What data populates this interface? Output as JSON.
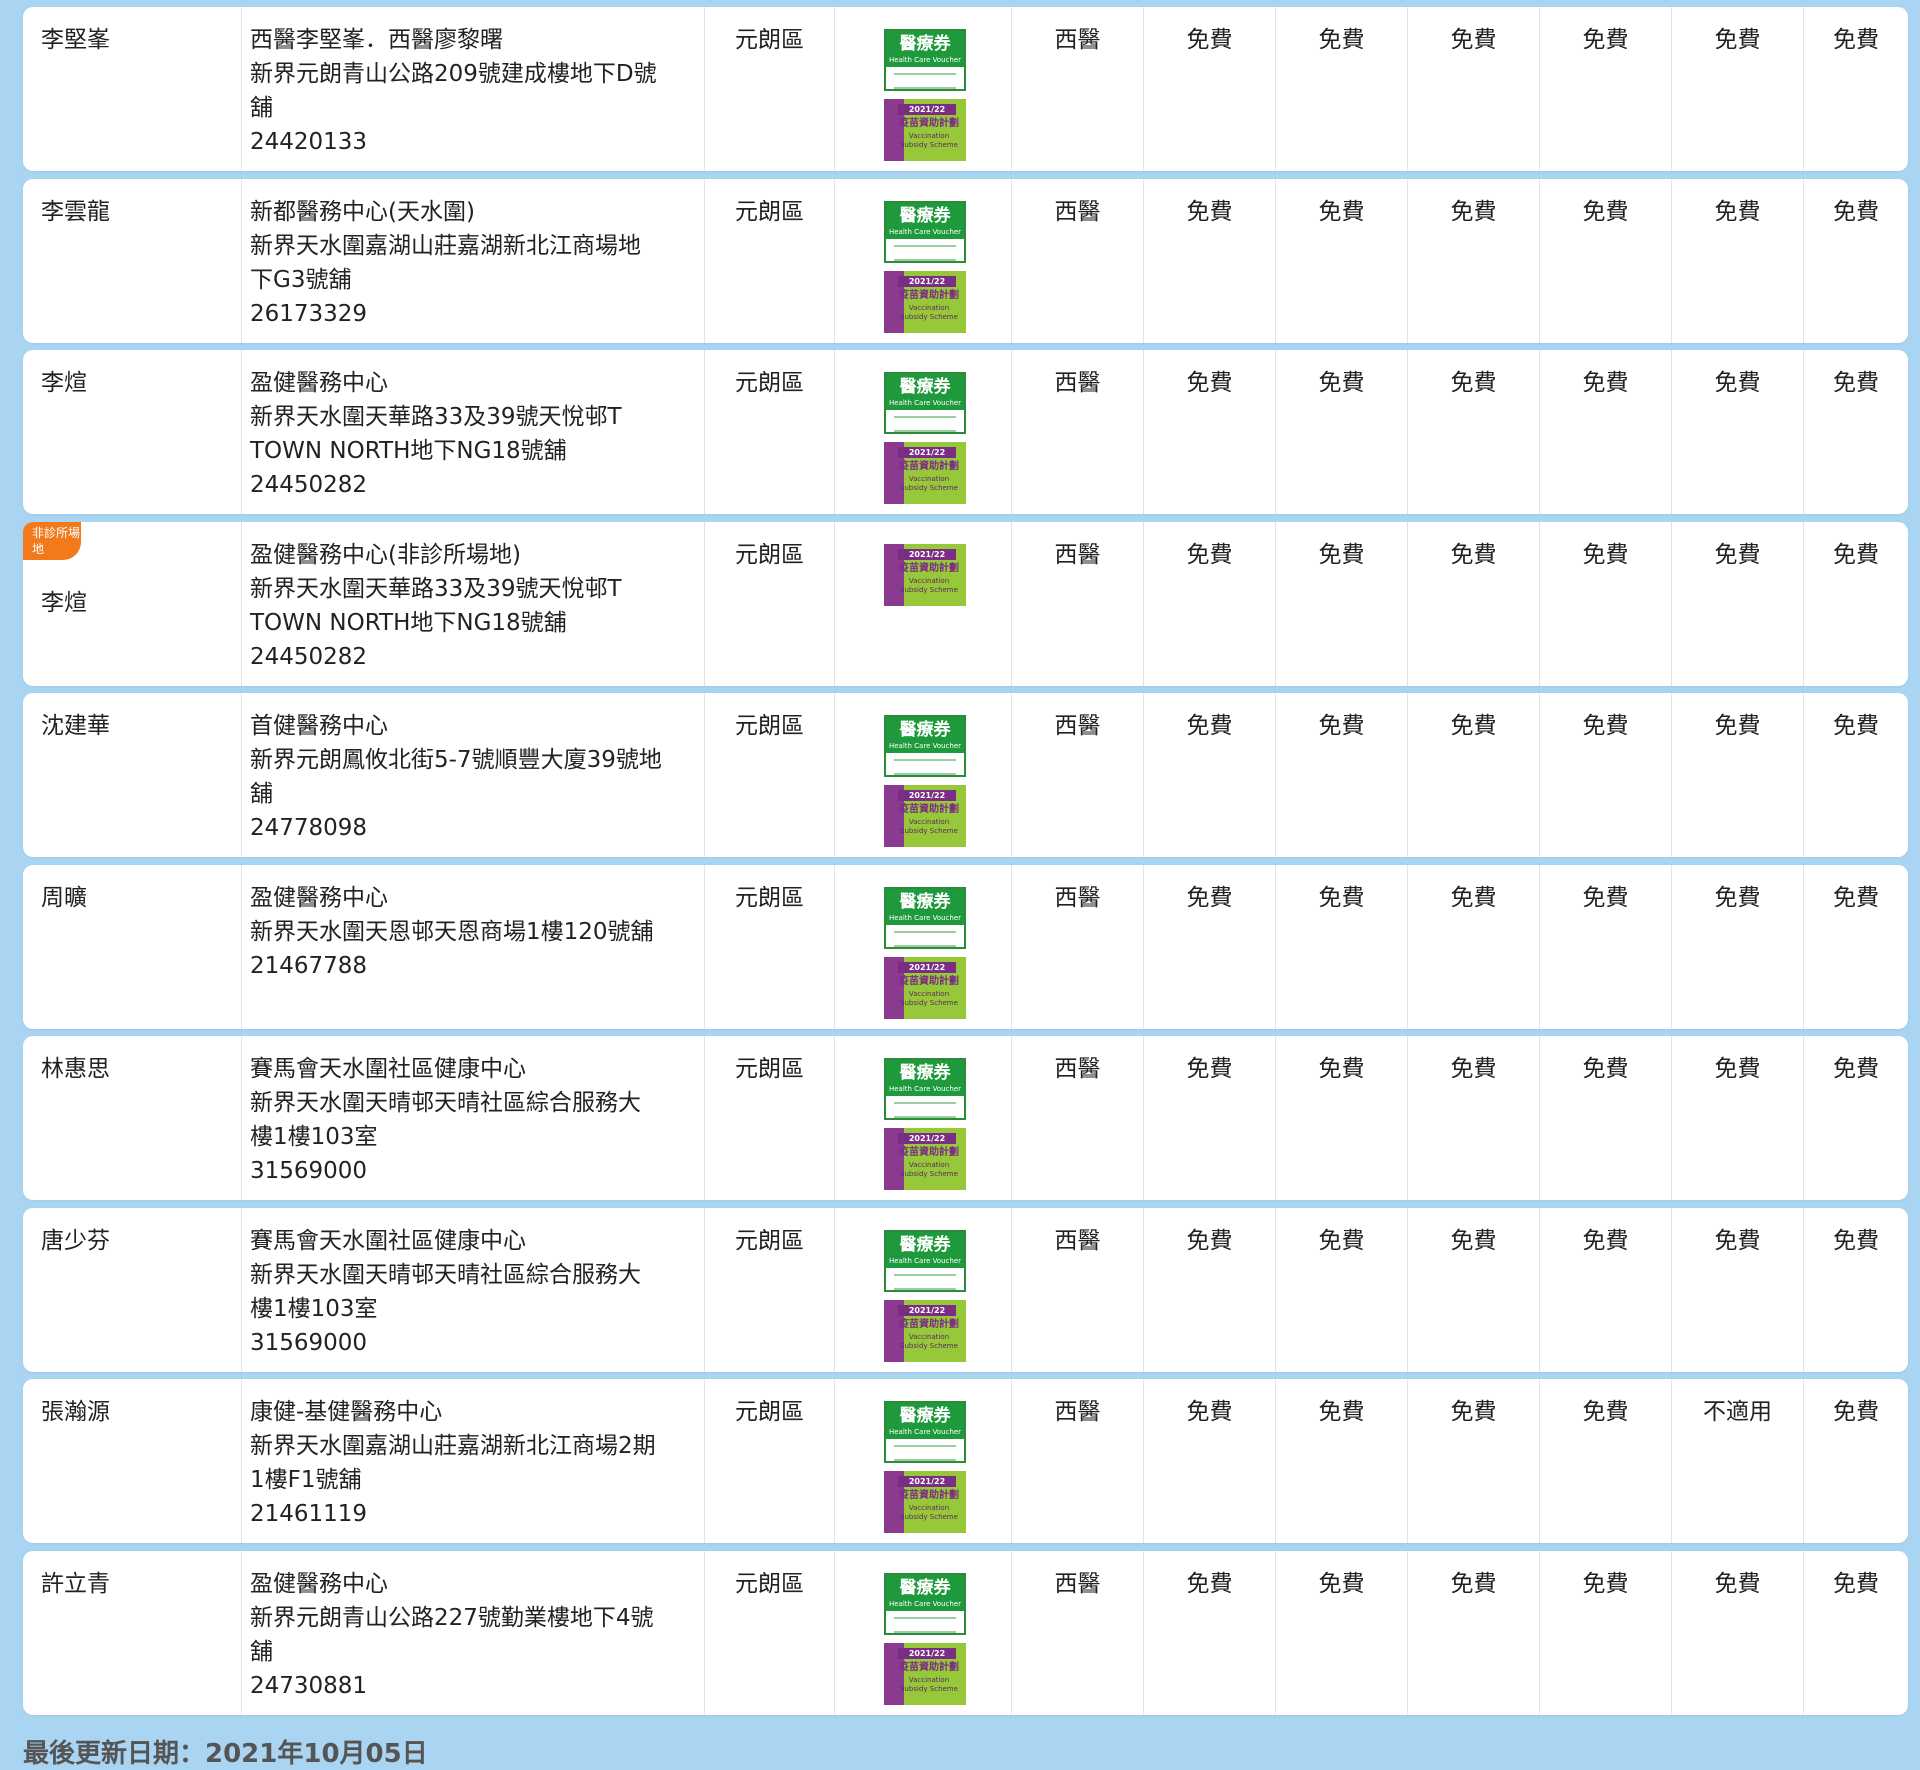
{
  "icons": {
    "hcv_title": "醫療券",
    "hcv_en": "Health Care Voucher",
    "vss_year": "2021/22",
    "vss_zh": "疫苗資助計劃",
    "vss_en": "Vaccination Subsidy Scheme"
  },
  "badge_label": "非診所場地",
  "rows": [
    {
      "name": "李堅峯",
      "address_lines": [
        "西醫李堅峯．西醫廖黎曙",
        "新界元朗青山公路209號建成樓地下D號",
        "舖",
        "24420133"
      ],
      "district": "元朗區",
      "hcv": true,
      "vss": true,
      "type": "西醫",
      "fees": [
        "免費",
        "免費",
        "免費",
        "免費",
        "免費",
        "免費"
      ],
      "badge": false
    },
    {
      "name": "李雲龍",
      "address_lines": [
        "新都醫務中心(天水圍)",
        "新界天水圍嘉湖山莊嘉湖新北江商場地",
        "下G3號舖",
        "26173329"
      ],
      "district": "元朗區",
      "hcv": true,
      "vss": true,
      "type": "西醫",
      "fees": [
        "免費",
        "免費",
        "免費",
        "免費",
        "免費",
        "免費"
      ],
      "badge": false
    },
    {
      "name": "李煊",
      "address_lines": [
        "盈健醫務中心",
        "新界天水圍天華路33及39號天悅邨T",
        "TOWN NORTH地下NG18號舖",
        "24450282"
      ],
      "district": "元朗區",
      "hcv": true,
      "vss": true,
      "type": "西醫",
      "fees": [
        "免費",
        "免費",
        "免費",
        "免費",
        "免費",
        "免費"
      ],
      "badge": false
    },
    {
      "name": "李煊",
      "address_lines": [
        "盈健醫務中心(非診所場地)",
        "新界天水圍天華路33及39號天悅邨T",
        "TOWN NORTH地下NG18號舖",
        "24450282"
      ],
      "district": "元朗區",
      "hcv": false,
      "vss": true,
      "type": "西醫",
      "fees": [
        "免費",
        "免費",
        "免費",
        "免費",
        "免費",
        "免費"
      ],
      "badge": true
    },
    {
      "name": "沈建華",
      "address_lines": [
        "首健醫務中心",
        "新界元朗鳳攸北街5-7號順豐大廈39號地",
        "舖",
        "24778098"
      ],
      "district": "元朗區",
      "hcv": true,
      "vss": true,
      "type": "西醫",
      "fees": [
        "免費",
        "免費",
        "免費",
        "免費",
        "免費",
        "免費"
      ],
      "badge": false
    },
    {
      "name": "周曠",
      "address_lines": [
        "盈健醫務中心",
        "新界天水圍天恩邨天恩商場1樓120號舖",
        "21467788"
      ],
      "district": "元朗區",
      "hcv": true,
      "vss": true,
      "type": "西醫",
      "fees": [
        "免費",
        "免費",
        "免費",
        "免費",
        "免費",
        "免費"
      ],
      "badge": false
    },
    {
      "name": "林惠思",
      "address_lines": [
        "賽馬會天水圍社區健康中心",
        "新界天水圍天晴邨天晴社區綜合服務大",
        "樓1樓103室",
        "31569000"
      ],
      "district": "元朗區",
      "hcv": true,
      "vss": true,
      "type": "西醫",
      "fees": [
        "免費",
        "免費",
        "免費",
        "免費",
        "免費",
        "免費"
      ],
      "badge": false
    },
    {
      "name": "唐少芬",
      "address_lines": [
        "賽馬會天水圍社區健康中心",
        "新界天水圍天晴邨天晴社區綜合服務大",
        "樓1樓103室",
        "31569000"
      ],
      "district": "元朗區",
      "hcv": true,
      "vss": true,
      "type": "西醫",
      "fees": [
        "免費",
        "免費",
        "免費",
        "免費",
        "免費",
        "免費"
      ],
      "badge": false
    },
    {
      "name": "張瀚源",
      "address_lines": [
        "康健-基健醫務中心",
        "新界天水圍嘉湖山莊嘉湖新北江商場2期",
        "1樓F1號舖",
        "21461119"
      ],
      "district": "元朗區",
      "hcv": true,
      "vss": true,
      "type": "西醫",
      "fees": [
        "免費",
        "免費",
        "免費",
        "免費",
        "不適用",
        "免費"
      ],
      "badge": false
    },
    {
      "name": "許立青",
      "address_lines": [
        "盈健醫務中心",
        "新界元朗青山公路227號勤業樓地下4號",
        "舖",
        "24730881"
      ],
      "district": "元朗區",
      "hcv": true,
      "vss": true,
      "type": "西醫",
      "fees": [
        "免費",
        "免費",
        "免費",
        "免費",
        "免費",
        "免費"
      ],
      "badge": false
    }
  ],
  "footer_text": "最後更新日期：2021年10月05日"
}
